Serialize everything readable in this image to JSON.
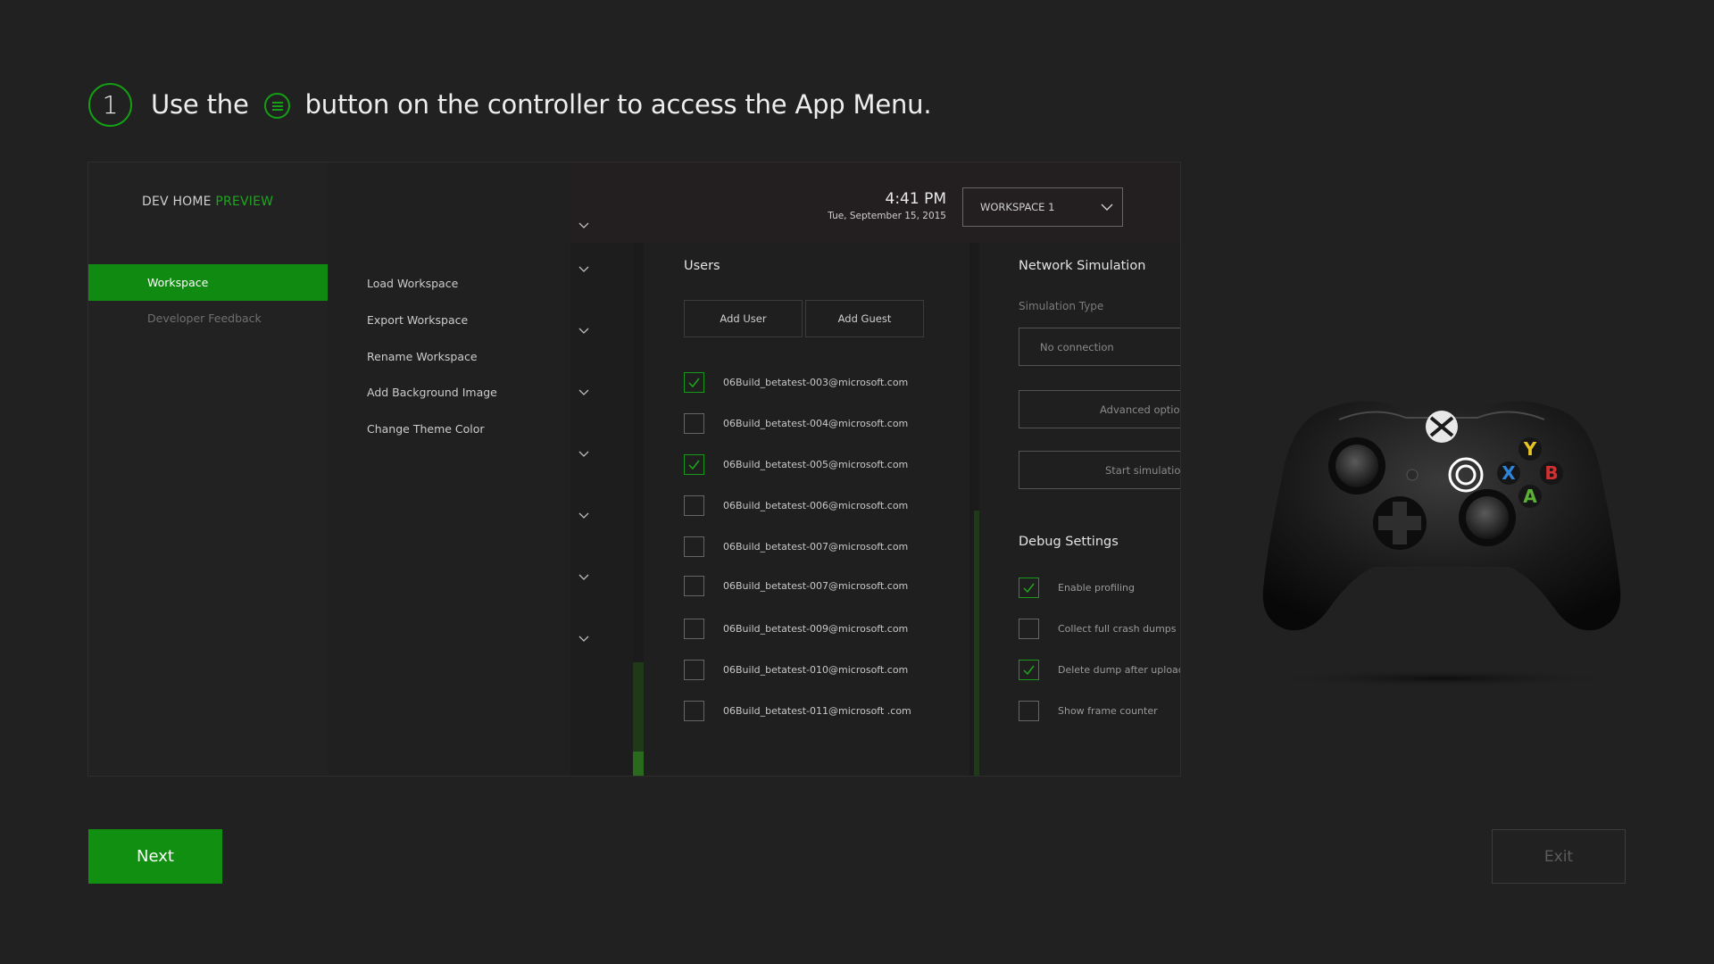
{
  "step": {
    "number": "1",
    "text_before": "Use the",
    "icon": "menu-button-icon",
    "text_after": "button on the controller to access the App Menu."
  },
  "preview": {
    "brand": {
      "name": "DEV HOME",
      "accent": "PREVIEW"
    },
    "nav": {
      "items": [
        {
          "label": "Workspace",
          "active": true
        },
        {
          "label": "Developer Feedback",
          "active": false
        }
      ]
    },
    "submenu": {
      "items": [
        "Load Workspace",
        "Export Workspace",
        "Rename Workspace",
        "Add Background Image",
        "Change Theme Color"
      ]
    },
    "header": {
      "time": "4:41 PM",
      "date": "Tue, September 15, 2015",
      "workspace_dropdown": "WORKSPACE 1"
    },
    "users": {
      "title": "Users",
      "add_user": "Add User",
      "add_guest": "Add Guest",
      "list": [
        {
          "email": "06Build_betatest-003@microsoft.com",
          "checked": true
        },
        {
          "email": "06Build_betatest-004@microsoft.com",
          "checked": false
        },
        {
          "email": "06Build_betatest-005@microsoft.com",
          "checked": true
        },
        {
          "email": "06Build_betatest-006@microsoft.com",
          "checked": false
        },
        {
          "email": "06Build_betatest-007@microsoft.com",
          "checked": false
        },
        {
          "email": "06Build_betatest-007@microsoft.com",
          "checked": false
        },
        {
          "email": "06Build_betatest-009@microsoft.com",
          "checked": false
        },
        {
          "email": "06Build_betatest-010@microsoft.com",
          "checked": false
        },
        {
          "email": "06Build_betatest-011@microsoft .com",
          "checked": false
        }
      ]
    },
    "network": {
      "title": "Network Simulation",
      "simulation_type_label": "Simulation Type",
      "simulation_type_value": "No connection",
      "advanced_options": "Advanced option",
      "start_simulation": "Start simulation"
    },
    "debug": {
      "title": "Debug Settings",
      "items": [
        {
          "label": "Enable profiling",
          "checked": true
        },
        {
          "label": "Collect full crash dumps",
          "checked": false
        },
        {
          "label": "Delete dump after upload",
          "checked": true
        },
        {
          "label": "Show frame counter",
          "checked": false
        }
      ]
    }
  },
  "controller": {
    "buttons": {
      "y": "Y",
      "x": "X",
      "b": "B",
      "a": "A"
    }
  },
  "footer": {
    "next_label": "Next",
    "exit_label": "Exit"
  },
  "colors": {
    "accent": "#108f10",
    "background": "#212121",
    "button_y": "#e7c424",
    "button_x": "#2f83d8",
    "button_b": "#d23030",
    "button_a": "#5bb135"
  }
}
